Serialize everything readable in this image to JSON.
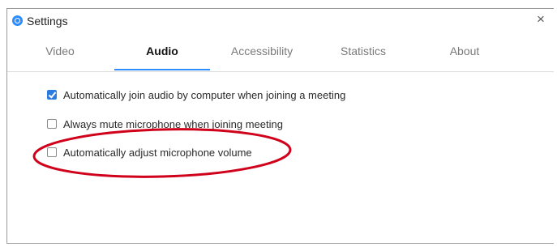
{
  "window": {
    "title": "Settings",
    "close_glyph": "×"
  },
  "tabs": [
    {
      "label": "Video",
      "active": false
    },
    {
      "label": "Audio",
      "active": true
    },
    {
      "label": "Accessibility",
      "active": false
    },
    {
      "label": "Statistics",
      "active": false
    },
    {
      "label": "About",
      "active": false
    }
  ],
  "audio_options": [
    {
      "label": "Automatically join audio by computer when joining a meeting",
      "checked": true
    },
    {
      "label": "Always mute microphone when joining meeting",
      "checked": false
    },
    {
      "label": "Automatically adjust microphone volume",
      "checked": false
    }
  ],
  "colors": {
    "accent": "#2d8cff",
    "annotation": "#d0021b"
  },
  "icons": {
    "app": "app-logo-icon",
    "close": "close-icon",
    "annotation": "red-ellipse-annotation"
  }
}
